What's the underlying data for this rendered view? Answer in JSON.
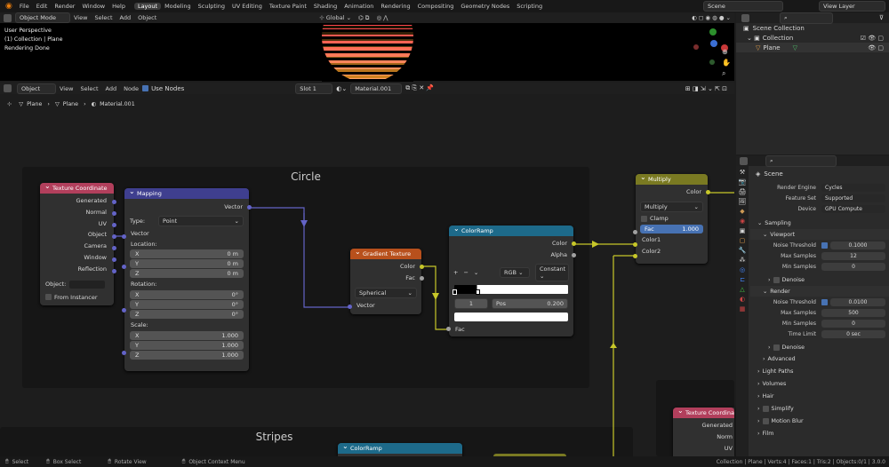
{
  "topbar": {
    "menus": [
      "File",
      "Edit",
      "Render",
      "Window",
      "Help"
    ],
    "workspaces": [
      "Layout",
      "Modeling",
      "Sculpting",
      "UV Editing",
      "Texture Paint",
      "Shading",
      "Animation",
      "Rendering",
      "Compositing",
      "Geometry Nodes",
      "Scripting"
    ],
    "scene": "Scene",
    "view_layer": "View Layer"
  },
  "viewport": {
    "mode": "Object Mode",
    "menus": [
      "View",
      "Select",
      "Add",
      "Object"
    ],
    "transform": "Global",
    "info": [
      "User Perspective",
      "(1) Collection | Plane",
      "Rendering Done"
    ]
  },
  "outliner": {
    "search": "",
    "items": [
      "Scene Collection",
      "Collection",
      "Plane"
    ]
  },
  "node_editor": {
    "mode": "Object",
    "menus": [
      "View",
      "Select",
      "Add",
      "Node"
    ],
    "use_nodes": "Use Nodes",
    "slot": "Slot 1",
    "material": "Material.001",
    "breadcrumb": [
      "Plane",
      "Plane",
      "Material.001"
    ]
  },
  "frames": {
    "circle": "Circle",
    "stripes": "Stripes"
  },
  "tex_coord": {
    "title": "Texture Coordinate",
    "outputs": [
      "Generated",
      "Normal",
      "UV",
      "Object",
      "Camera",
      "Window",
      "Reflection"
    ],
    "object_label": "Object:",
    "from_instancer": "From Instancer"
  },
  "mapping": {
    "title": "Mapping",
    "out": "Vector",
    "type_label": "Type:",
    "type": "Point",
    "in": "Vector",
    "loc_label": "Location:",
    "loc": [
      [
        "X",
        "0 m"
      ],
      [
        "Y",
        "0 m"
      ],
      [
        "Z",
        "0 m"
      ]
    ],
    "rot_label": "Rotation:",
    "rot": [
      [
        "X",
        "0°"
      ],
      [
        "Y",
        "0°"
      ],
      [
        "Z",
        "0°"
      ]
    ],
    "scale_label": "Scale:",
    "scale": [
      [
        "X",
        "1.000"
      ],
      [
        "Y",
        "1.000"
      ],
      [
        "Z",
        "1.000"
      ]
    ]
  },
  "gradient": {
    "title": "Gradient Texture",
    "outputs": [
      "Color",
      "Fac"
    ],
    "type": "Spherical",
    "in": "Vector"
  },
  "colorramp": {
    "title": "ColorRamp",
    "outputs": [
      "Color",
      "Alpha"
    ],
    "add": "+",
    "remove": "−",
    "mode": "RGB",
    "interp": "Constant",
    "index": "1",
    "pos_label": "Pos",
    "pos": "0.200",
    "in": "Fac"
  },
  "multiply": {
    "title": "Multiply",
    "out": "Color",
    "op": "Multiply",
    "clamp": "Clamp",
    "fac_label": "Fac",
    "fac": "1.000",
    "inputs": [
      "Color1",
      "Color2"
    ]
  },
  "tex_coord2": {
    "title": "Texture Coordinate",
    "outputs": [
      "Generated",
      "Norm",
      "UV"
    ]
  },
  "colorramp2": {
    "title": "ColorRamp"
  },
  "properties": {
    "scene": "Scene",
    "render_engine_label": "Render Engine",
    "render_engine": "Cycles",
    "feature_set_label": "Feature Set",
    "feature_set": "Supported",
    "device_label": "Device",
    "device": "GPU Compute",
    "sampling": "Sampling",
    "viewport": "Viewport",
    "noise_threshold_label": "Noise Threshold",
    "vp_noise": "0.1000",
    "max_samples_label": "Max Samples",
    "vp_max": "12",
    "min_samples_label": "Min Samples",
    "vp_min": "0",
    "denoise": "Denoise",
    "render": "Render",
    "r_noise": "0.0100",
    "r_max": "500",
    "r_min": "0",
    "time_limit_label": "Time Limit",
    "r_time": "0 sec",
    "advanced": "Advanced",
    "sections": [
      "Light Paths",
      "Volumes",
      "Hair",
      "Simplify",
      "Motion Blur",
      "Film"
    ]
  },
  "status": {
    "items": [
      "Select",
      "Box Select",
      "Rotate View",
      "Object Context Menu"
    ],
    "right": "Collection | Plane | Verts:4 | Faces:1 | Tris:2 | Objects:0/1 | 3.0.0"
  },
  "colors": {
    "accent": "#4772b3",
    "yellow_wire": "#c7c729",
    "purple_wire": "#6363c7"
  }
}
